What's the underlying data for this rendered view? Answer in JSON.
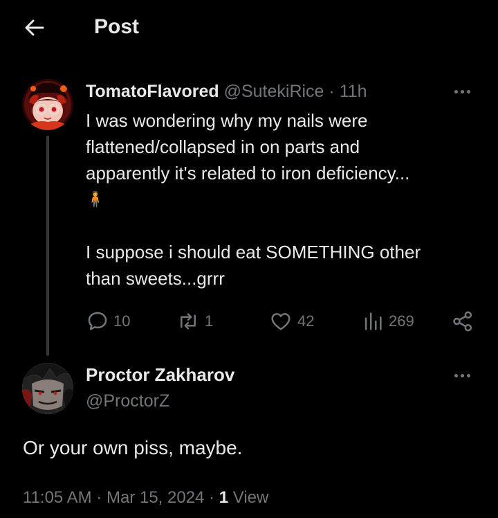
{
  "header": {
    "title": "Post",
    "back_icon": "arrow-left-icon"
  },
  "reply": {
    "display_name": "TomatoFlavored",
    "handle": "@SutekiRice",
    "separator": "·",
    "time": "11h",
    "text_lines": [
      "I was wondering why my nails were",
      "flattened/collapsed in on parts and",
      "apparently it's related to iron deficiency..."
    ],
    "emoji": "🧍",
    "text_lines_2": [
      "I suppose i should eat SOMETHING other",
      "than sweets...grrr"
    ],
    "stats": {
      "replies": "10",
      "reposts": "1",
      "likes": "42",
      "views": "269"
    },
    "icons": {
      "reply": "comment-bubble-icon",
      "repost": "repost-icon",
      "like": "heart-icon",
      "views": "analytics-bars-icon",
      "share": "share-icon",
      "more": "more-dots-icon"
    }
  },
  "main_post": {
    "display_name": "Proctor Zakharov",
    "handle": "@ProctorZ",
    "text": "Or your own piss, maybe.",
    "time": "11:05 AM",
    "separator": "·",
    "date": "Mar 15, 2024",
    "views_count": "1",
    "views_label": "View"
  },
  "colors": {
    "background": "#000000",
    "primary_text": "#e7e9ea",
    "secondary_text": "#71767b",
    "thread_line": "#333639"
  }
}
